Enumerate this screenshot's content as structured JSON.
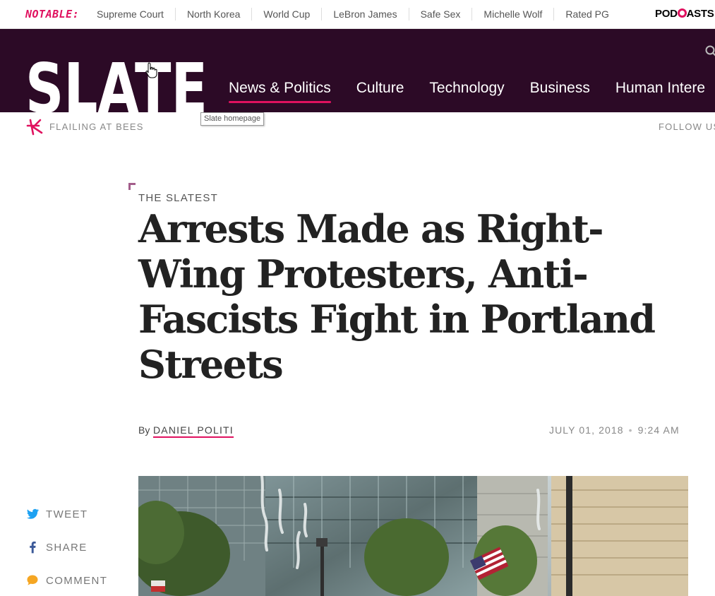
{
  "notable": {
    "label": "NOTABLE:",
    "links": [
      "Supreme Court",
      "North Korea",
      "World Cup",
      "LeBron James",
      "Safe Sex",
      "Michelle Wolf",
      "Rated PG"
    ],
    "podcasts_pre": "POD",
    "podcasts_post": "ASTS"
  },
  "nav": {
    "logo_text": "SLATE",
    "items": [
      {
        "label": "News & Politics",
        "active": true
      },
      {
        "label": "Culture",
        "active": false
      },
      {
        "label": "Technology",
        "active": false
      },
      {
        "label": "Business",
        "active": false
      },
      {
        "label": "Human Intere",
        "active": false
      }
    ],
    "tooltip": "Slate homepage"
  },
  "blog": {
    "name": "FLAILING AT BEES",
    "follow": "FOLLOW US"
  },
  "article": {
    "kicker": "THE SLATEST",
    "headline": "Arrests Made as Right-Wing Protesters, Anti-Fascists Fight in Portland Streets",
    "by": "By",
    "author": "DANIEL POLITI",
    "date": "JULY 01, 2018",
    "time": "9:24 AM"
  },
  "share": {
    "tweet": "TWEET",
    "share": "SHARE",
    "comment": "COMMENT"
  },
  "colors": {
    "brand_pink": "#e0115f",
    "nav_bg": "#2c0a26",
    "twitter_blue": "#1da1f2",
    "facebook_blue": "#3b5998",
    "comment_orange": "#f5a623"
  }
}
